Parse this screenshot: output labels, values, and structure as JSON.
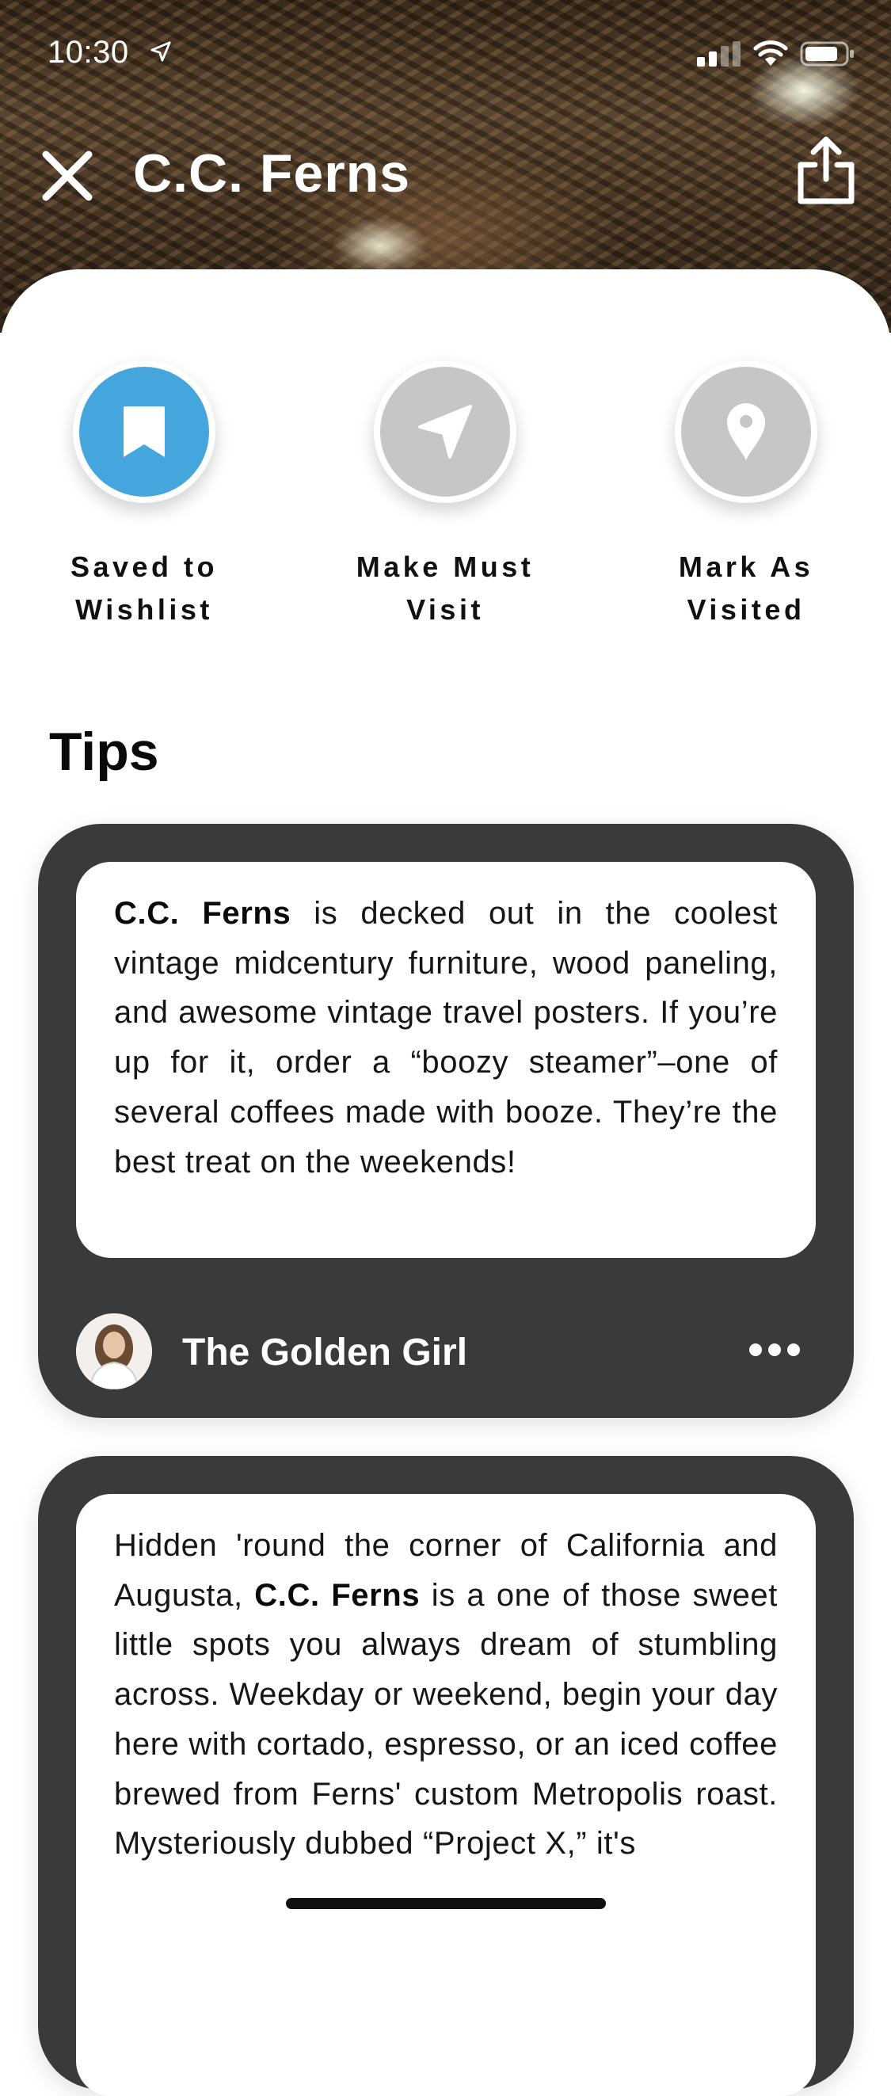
{
  "status_bar": {
    "time": "10:30"
  },
  "header": {
    "title": "C.C. Ferns"
  },
  "actions": [
    {
      "label_line1": "Saved to",
      "label_line2": "Wishlist",
      "icon": "bookmark-icon",
      "color": "#45A6DE",
      "active": true
    },
    {
      "label_line1": "Make Must",
      "label_line2": "Visit",
      "icon": "navigation-arrow-icon",
      "color": "#C6C6C6",
      "active": false
    },
    {
      "label_line1": "Mark As",
      "label_line2": "Visited",
      "icon": "map-pin-icon",
      "color": "#C6C6C6",
      "active": false
    }
  ],
  "tips_heading": "Tips",
  "tips": [
    {
      "venue": "C.C. Ferns",
      "text": " is decked out in the coolest vintage midcentury furniture, wood paneling, and awesome vintage travel posters. If you’re up for it, order a “boozy steamer”–one of several coffees made with booze. They’re the best treat on the weekends!",
      "author": "The Golden Girl"
    },
    {
      "text_before": "Hidden 'round the corner of California and Augusta, ",
      "venue": "C.C. Ferns",
      "text_after": " is a one of those sweet little spots you always dream of stumbling across. Weekday or weekend, begin your day here with cortado, espresso, or an iced coffee brewed from Ferns' custom Metropolis roast. Mysteriously dubbed “Project X,” it's"
    }
  ],
  "colors": {
    "accent": "#45A6DE",
    "card": "#3A3A3A",
    "inactive": "#C6C6C6"
  }
}
